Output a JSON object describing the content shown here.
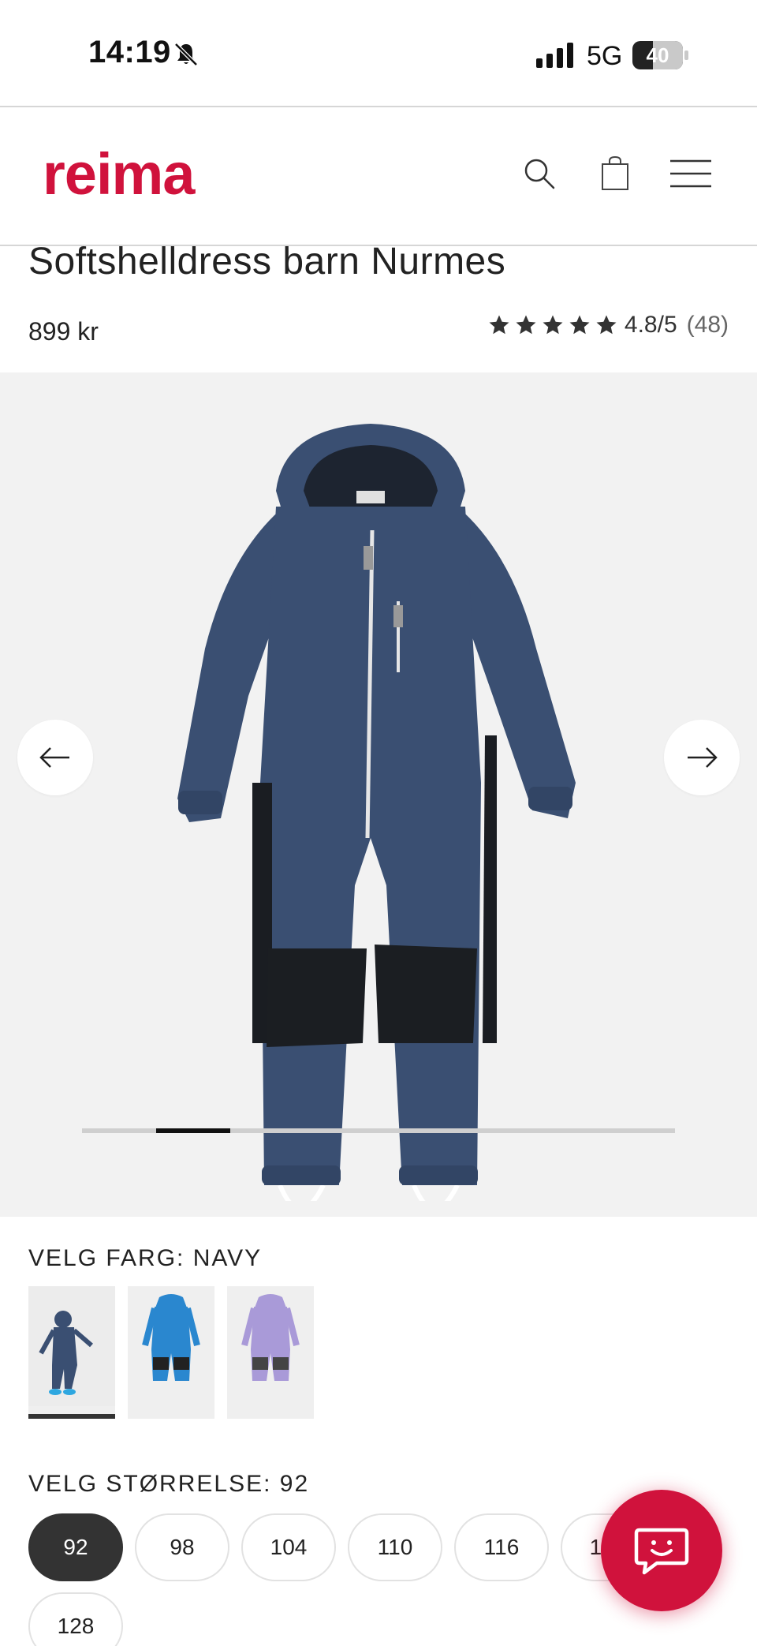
{
  "status_bar": {
    "time": "14:19",
    "network": "5G",
    "battery": "40",
    "battery_level_percent": 40
  },
  "header": {
    "logo_text": "reima",
    "icons": [
      "search-icon",
      "shopping-bag-icon",
      "menu-icon"
    ]
  },
  "product": {
    "title": "Softshelldress barn Nurmes",
    "price": "899 kr",
    "rating_value": "4.8/5",
    "rating_count": "(48)",
    "stars": 5
  },
  "gallery": {
    "progress_start_fraction": 0.125,
    "progress_length_fraction": 0.125
  },
  "color": {
    "label": "VELG FARG: NAVY",
    "swatches": [
      {
        "name": "navy",
        "selected": true
      },
      {
        "name": "blue",
        "selected": false
      },
      {
        "name": "lilac",
        "selected": false
      }
    ]
  },
  "size": {
    "label": "VELG STØRRELSE: 92",
    "options": [
      "92",
      "98",
      "104",
      "110",
      "116",
      "122",
      "128"
    ],
    "selected": "92"
  },
  "colors": {
    "brand_red": "#d0123c",
    "navy": "#3a4f72",
    "selected_pill": "#333333"
  }
}
